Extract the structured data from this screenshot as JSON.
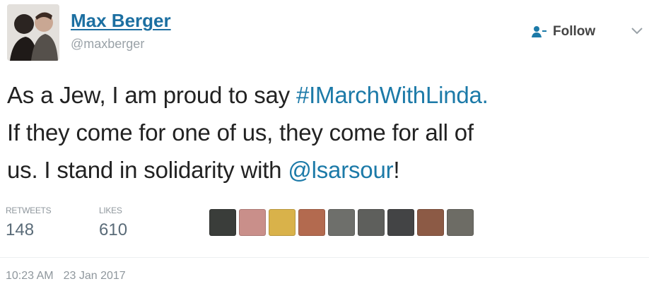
{
  "user": {
    "name": "Max Berger",
    "handle": "@maxberger"
  },
  "follow_button": {
    "label": "Follow",
    "icon": "follow-person-plus-icon"
  },
  "menu": {
    "icon": "chevron-down-icon"
  },
  "tweet": {
    "line1_text": "As a Jew, I am proud to say ",
    "line1_hashtag": "#IMarchWithLinda.",
    "line2": "If they come for one of us, they come for all of",
    "line3_text": "us. I stand in solidarity with ",
    "line3_mention": "@lsarsour",
    "line3_end": "!"
  },
  "stats": {
    "retweets_label": "RETWEETS",
    "retweets": "148",
    "likes_label": "LIKES",
    "likes": "610"
  },
  "likers": [
    "#3a3d3a",
    "#c98f8a",
    "#d9b24a",
    "#b36a4f",
    "#6e6f6b",
    "#5e5f5c",
    "#434445",
    "#8c5a45",
    "#6d6c65"
  ],
  "timestamp": {
    "time": "10:23 AM",
    "date": "23 Jan 2017"
  },
  "colors": {
    "link": "#1c7aa8",
    "name": "#1c6fa1",
    "muted": "#8f979d"
  }
}
